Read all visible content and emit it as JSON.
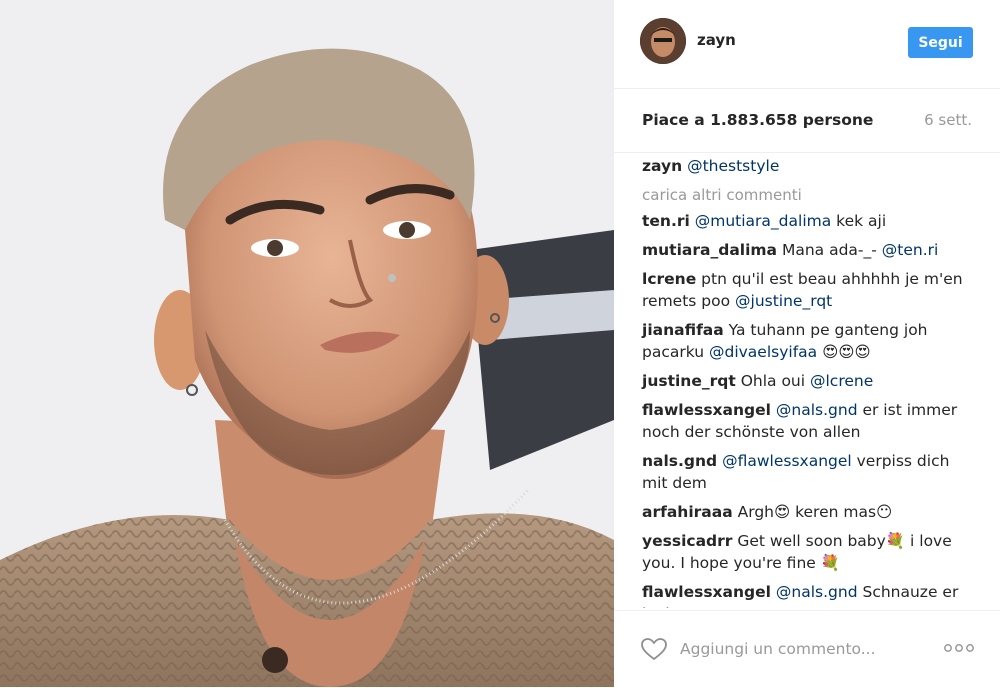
{
  "post": {
    "username": "zayn",
    "follow_label": "Segui",
    "likes": "Piace a 1.883.658 persone",
    "time": "6 sett.",
    "caption": {
      "user": "zayn",
      "text": "@theststyle"
    },
    "load_more": "carica altri commenti",
    "add_comment_placeholder": "Aggiungi un commento..."
  },
  "comments": [
    {
      "user": "ten.ri",
      "parts": [
        {
          "t": "@mutiara_dalima",
          "m": true
        },
        {
          "t": " kek aji"
        }
      ]
    },
    {
      "user": "mutiara_dalima",
      "parts": [
        {
          "t": "Mana ada-_- "
        },
        {
          "t": "@ten.ri",
          "m": true
        }
      ]
    },
    {
      "user": "lcrene",
      "parts": [
        {
          "t": "ptn qu'il est beau ahhhhh je m'en remets poo "
        },
        {
          "t": "@justine_rqt",
          "m": true
        }
      ]
    },
    {
      "user": "jianafifaa",
      "parts": [
        {
          "t": "Ya tuhann pe ganteng joh pacarku "
        },
        {
          "t": "@divaelsyifaa",
          "m": true
        },
        {
          "t": " 😍😍😍"
        }
      ]
    },
    {
      "user": "justine_rqt",
      "parts": [
        {
          "t": "Ohla oui "
        },
        {
          "t": "@lcrene",
          "m": true
        }
      ]
    },
    {
      "user": "flawlessxangel",
      "parts": [
        {
          "t": "@nals.gnd",
          "m": true
        },
        {
          "t": " er ist immer noch der schönste von allen"
        }
      ]
    },
    {
      "user": "nals.gnd",
      "parts": [
        {
          "t": "@flawlessxangel",
          "m": true
        },
        {
          "t": " verpiss dich mit dem"
        }
      ]
    },
    {
      "user": "arfahiraaa",
      "parts": [
        {
          "t": "Argh😍 keren mas😶"
        }
      ]
    },
    {
      "user": "yessicadrr",
      "parts": [
        {
          "t": "Get well soon baby💐 i love you. I hope you're fine 💐"
        }
      ]
    },
    {
      "user": "flawlessxangel",
      "parts": [
        {
          "t": "@nals.gnd",
          "m": true
        },
        {
          "t": " Schnauze er ist hayat"
        }
      ]
    }
  ],
  "icons": {
    "like": "heart-outline-icon",
    "more": "more-options-icon"
  },
  "colors": {
    "accent": "#3897f0",
    "mention": "#003569",
    "muted": "#999999"
  }
}
